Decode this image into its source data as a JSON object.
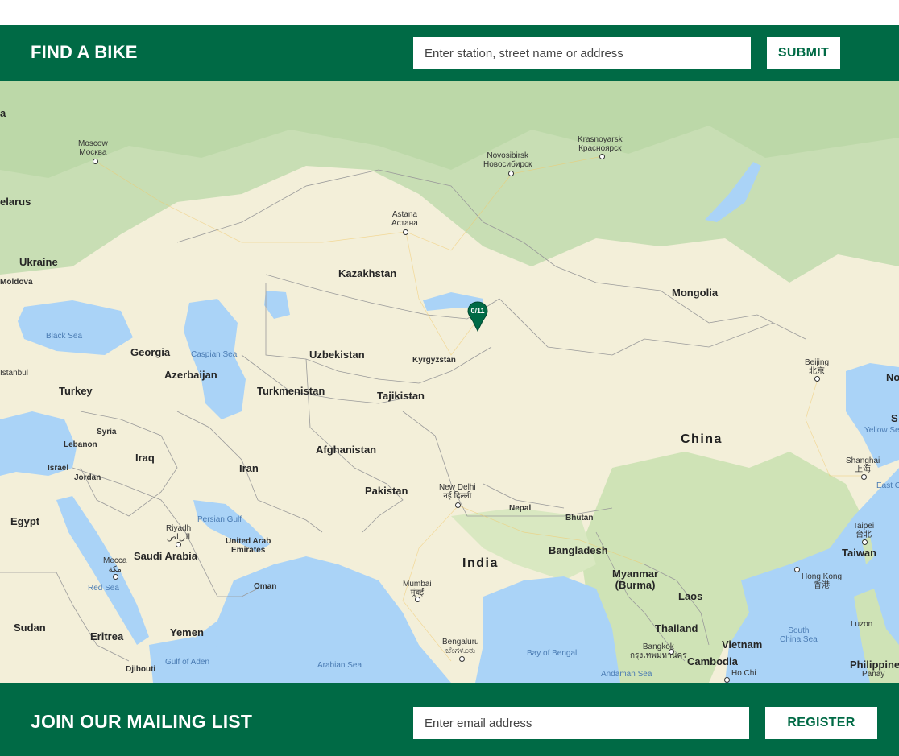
{
  "find_bike": {
    "title": "FIND A BIKE",
    "search_placeholder": "Enter station, street name or address",
    "submit_label": "SUBMIT"
  },
  "map": {
    "marker_label": "0/11",
    "labels": {
      "moscow": "Moscow\nМосква",
      "novosibirsk": "Novosibirsk\nНовосибирск",
      "krasnoyarsk": "Krasnoyarsk\nКрасноярск",
      "astana": "Astana\nАстана",
      "belarus": "elarus",
      "ukraine": "Ukraine",
      "moldova": "Moldova",
      "kazakhstan": "Kazakhstan",
      "mongolia": "Mongolia",
      "black_sea": "Black Sea",
      "georgia": "Georgia",
      "caspian_sea": "Caspian Sea",
      "uzbekistan": "Uzbekistan",
      "kyrgyzstan": "Kyrgyzstan",
      "beijing": "Beijing\n北京",
      "istanbul": "Istanbul",
      "azerbaijan": "Azerbaijan",
      "turkey": "Turkey",
      "turkmenistan": "Turkmenistan",
      "tajikistan": "Tajikistan",
      "china": "China",
      "syria": "Syria",
      "lebanon": "Lebanon",
      "israel": "Israel",
      "jordan": "Jordan",
      "iraq": "Iraq",
      "iran": "Iran",
      "afghanistan": "Afghanistan",
      "pakistan": "Pakistan",
      "new_delhi": "New Delhi\nनई दिल्ली",
      "nepal": "Nepal",
      "bhutan": "Bhutan",
      "shanghai": "Shanghai\n上海",
      "yellow_sea": "Yellow Se",
      "east_c": "East C",
      "egypt": "Egypt",
      "riyadh": "Riyadh\nالرياض",
      "persian_gulf": "Persian Gulf",
      "uae": "United Arab\nEmirates",
      "saudi_arabia": "Saudi Arabia",
      "mecca": "Mecca\nمكة",
      "india": "India",
      "bangladesh": "Bangladesh",
      "taipei": "Taipei\n台北",
      "taiwan": "Taiwan",
      "red_sea": "Red Sea",
      "oman": "Oman",
      "mumbai": "Mumbai\nमुंबई",
      "myanmar": "Myanmar\n(Burma)",
      "laos": "Laos",
      "hong_kong": "Hong Kong\n香港",
      "sudan": "Sudan",
      "yemen": "Yemen",
      "eritrea": "Eritrea",
      "thailand": "Thailand",
      "south_china_sea": "South\nChina Sea",
      "luzon": "Luzon",
      "bengaluru": "Bengaluru\nಬೆಂಗಳೂರು",
      "bay_of_bengal": "Bay of Bengal",
      "bangkok": "Bangkok\nกรุงเทพมหานคร",
      "vietnam": "Vietnam",
      "gulf_of_aden": "Gulf of Aden",
      "arabian_sea": "Arabian Sea",
      "djibouti": "Djibouti",
      "cambodia": "Cambodia",
      "andaman_sea": "Andaman Sea",
      "ho_chi": "Ho Chi",
      "philippine": "Philippine",
      "panay": "Panay",
      "no_edge": "No",
      "s_edge": "S",
      "a_edge": "a"
    },
    "colors": {
      "land": "#f3efd9",
      "forest": "#c7dfb2",
      "water": "#aad3f7",
      "brand": "#006a45"
    }
  },
  "mailing_list": {
    "title": "JOIN OUR MAILING LIST",
    "email_placeholder": "Enter email address",
    "register_label": "REGISTER"
  }
}
